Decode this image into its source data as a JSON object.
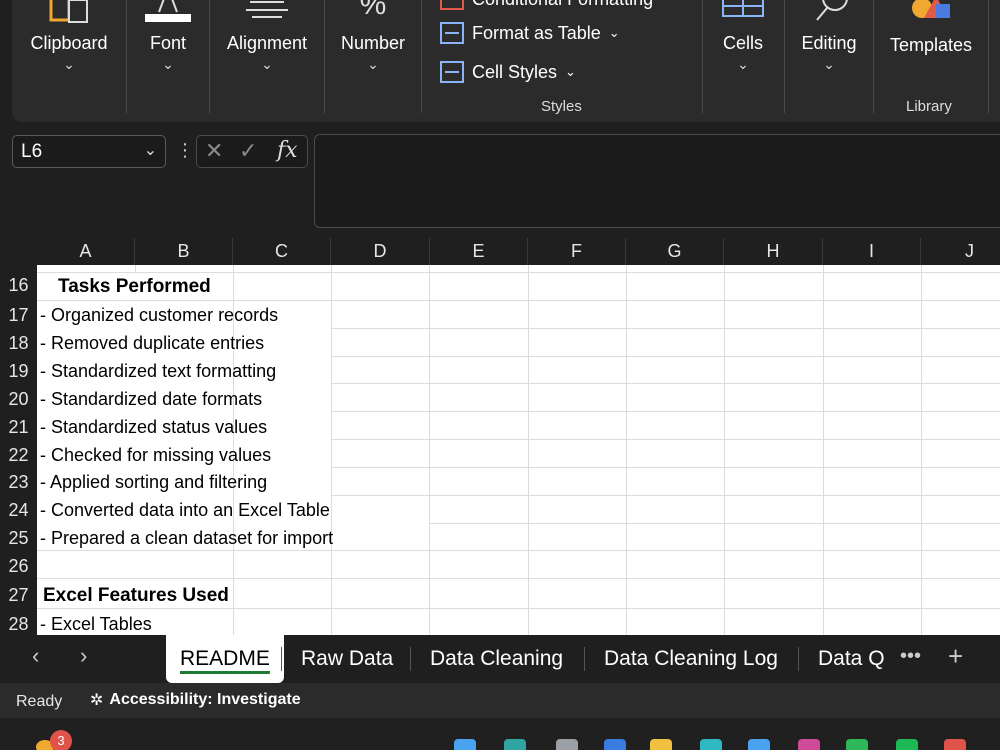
{
  "ribbon": {
    "groups": [
      {
        "label": "Clipboard",
        "icon": "clipboard-icon"
      },
      {
        "label": "Font",
        "icon": "font-icon"
      },
      {
        "label": "Alignment",
        "icon": "align-icon"
      },
      {
        "label": "Number",
        "icon": "percent-icon"
      },
      {
        "label": "Cells",
        "icon": "cells-icon"
      },
      {
        "label": "Editing",
        "icon": "search-icon"
      },
      {
        "label": "Templates",
        "icon": "shapes-icon"
      }
    ],
    "styles": {
      "conditional": "Conditional Formatting",
      "format_table": "Format as Table",
      "cell_styles": "Cell Styles",
      "group_label": "Styles"
    },
    "library_label": "Library"
  },
  "formula_bar": {
    "name_box": "L6",
    "formula": ""
  },
  "columns": [
    "A",
    "B",
    "C",
    "D",
    "E",
    "F",
    "G",
    "H",
    "I",
    "J"
  ],
  "rows": [
    {
      "num": "16",
      "text": "Tasks Performed",
      "bold": true
    },
    {
      "num": "17",
      "text": "- Organized customer records"
    },
    {
      "num": "18",
      "text": "- Removed duplicate entries"
    },
    {
      "num": "19",
      "text": "- Standardized text formatting"
    },
    {
      "num": "20",
      "text": "- Standardized date formats"
    },
    {
      "num": "21",
      "text": "- Standardized status values"
    },
    {
      "num": "22",
      "text": "- Checked for missing values"
    },
    {
      "num": "23",
      "text": "- Applied sorting and filtering"
    },
    {
      "num": "24",
      "text": "- Converted data into an Excel Table"
    },
    {
      "num": "25",
      "text": "- Prepared a clean dataset for import"
    },
    {
      "num": "26",
      "text": ""
    },
    {
      "num": "27",
      "text": "Excel Features Used",
      "bold": true
    },
    {
      "num": "28",
      "text": "- Excel Tables"
    }
  ],
  "tabs": [
    "README",
    "Raw Data",
    "Data Cleaning",
    "Data Cleaning Log",
    "Data Q"
  ],
  "active_tab": "README",
  "status": {
    "ready": "Ready",
    "accessibility": "Accessibility: Investigate"
  },
  "taskbar": {
    "notification_count": "3"
  },
  "colors": {
    "accent": "#1e7b34",
    "ribbon_bg": "#2b2b2b",
    "app_bg": "#1f1f1f"
  }
}
